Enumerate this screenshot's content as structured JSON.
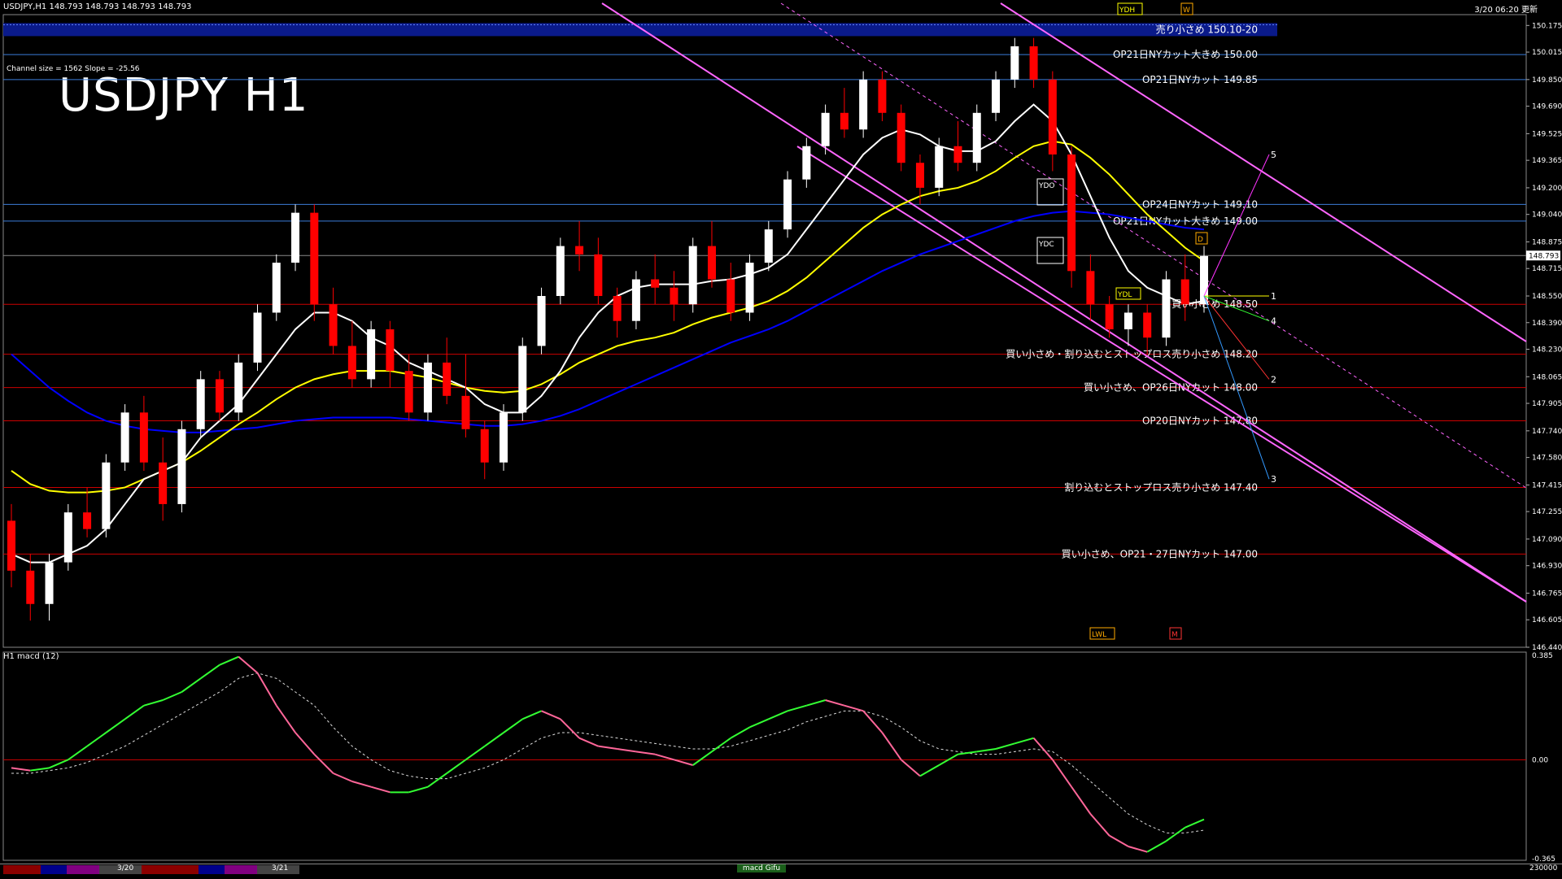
{
  "header": {
    "symbol_line": "USDJPY,H1  148.793 148.793 148.793 148.793",
    "updated": "3/20 06:20 更新"
  },
  "title": "USDJPY H1",
  "channel_info": "Channel size = 1562 Slope = -25.56",
  "macd_label": "H1  macd (12)",
  "colors": {
    "background": "#000000",
    "bull_candle": "#ffffff",
    "bear_candle": "#ff0000",
    "sma_short": "#ffffff",
    "sma_mid": "#ffff00",
    "sma_long": "#0000ff",
    "channel": "#ff66ff",
    "level_blue": "#3b7dd8",
    "level_red": "#cc0000",
    "macd_up": "#33ff33",
    "macd_down": "#ff6699"
  },
  "chart_data": {
    "type": "candlestick",
    "ylim": [
      146.44,
      150.24
    ],
    "price_ticks": [
      "150.175",
      "150.015",
      "149.850",
      "149.690",
      "149.525",
      "149.365",
      "149.200",
      "149.040",
      "148.875",
      "148.715",
      "148.550",
      "148.390",
      "148.230",
      "148.065",
      "147.905",
      "147.740",
      "147.580",
      "147.415",
      "147.255",
      "147.090",
      "146.930",
      "146.765",
      "146.605",
      "146.440"
    ],
    "current_price": "148.793",
    "levels": [
      {
        "price": 150.15,
        "label": "売り小さめ 150.10-20",
        "color": "#cc0000",
        "band": true
      },
      {
        "price": 150.0,
        "label": "OP21日NYカット大きめ 150.00",
        "color": "#3b7dd8"
      },
      {
        "price": 149.85,
        "label": "OP21日NYカット 149.85",
        "color": "#3b7dd8"
      },
      {
        "price": 149.1,
        "label": "OP24日NYカット 149.10",
        "color": "#3b7dd8"
      },
      {
        "price": 149.0,
        "label": "OP21日NYカット大きめ 149.00",
        "color": "#3b7dd8"
      },
      {
        "price": 148.5,
        "label": "買い小さめ 148.50",
        "color": "#cc0000"
      },
      {
        "price": 148.2,
        "label": "買い小さめ・割り込むとストップロス売り小さめ 148.20",
        "color": "#cc0000"
      },
      {
        "price": 148.0,
        "label": "買い小さめ、OP26日NYカット 148.00",
        "color": "#cc0000"
      },
      {
        "price": 147.8,
        "label": "OP20日NYカット 147.80",
        "color": "#cc0000"
      },
      {
        "price": 147.4,
        "label": "割り込むとストップロス売り小さめ 147.40",
        "color": "#cc0000"
      },
      {
        "price": 147.0,
        "label": "買い小さめ、OP21・27日NYカット 147.00",
        "color": "#cc0000"
      }
    ],
    "wave_labels": [
      "1",
      "2",
      "3",
      "4",
      "5"
    ],
    "box_labels": [
      "YDH",
      "YDO",
      "YDC",
      "YDL",
      "LWL",
      "W",
      "D",
      "M"
    ],
    "candles": [
      [
        147.2,
        147.3,
        146.8,
        146.9
      ],
      [
        146.9,
        147.0,
        146.6,
        146.7
      ],
      [
        146.7,
        147.0,
        146.6,
        146.95
      ],
      [
        146.95,
        147.3,
        146.9,
        147.25
      ],
      [
        147.25,
        147.4,
        147.1,
        147.15
      ],
      [
        147.15,
        147.6,
        147.1,
        147.55
      ],
      [
        147.55,
        147.9,
        147.5,
        147.85
      ],
      [
        147.85,
        147.95,
        147.5,
        147.55
      ],
      [
        147.55,
        147.7,
        147.2,
        147.3
      ],
      [
        147.3,
        147.8,
        147.25,
        147.75
      ],
      [
        147.75,
        148.1,
        147.7,
        148.05
      ],
      [
        148.05,
        148.1,
        147.8,
        147.85
      ],
      [
        147.85,
        148.2,
        147.8,
        148.15
      ],
      [
        148.15,
        148.5,
        148.1,
        148.45
      ],
      [
        148.45,
        148.8,
        148.4,
        148.75
      ],
      [
        148.75,
        149.1,
        148.7,
        149.05
      ],
      [
        149.05,
        149.1,
        148.4,
        148.5
      ],
      [
        148.5,
        148.6,
        148.2,
        148.25
      ],
      [
        148.25,
        148.4,
        148.0,
        148.05
      ],
      [
        148.05,
        148.4,
        148.0,
        148.35
      ],
      [
        148.35,
        148.4,
        148.0,
        148.1
      ],
      [
        148.1,
        148.2,
        147.8,
        147.85
      ],
      [
        147.85,
        148.2,
        147.8,
        148.15
      ],
      [
        148.15,
        148.3,
        147.9,
        147.95
      ],
      [
        147.95,
        148.2,
        147.7,
        147.75
      ],
      [
        147.75,
        147.8,
        147.45,
        147.55
      ],
      [
        147.55,
        147.9,
        147.5,
        147.85
      ],
      [
        147.85,
        148.3,
        147.8,
        148.25
      ],
      [
        148.25,
        148.6,
        148.2,
        148.55
      ],
      [
        148.55,
        148.9,
        148.5,
        148.85
      ],
      [
        148.85,
        149.0,
        148.7,
        148.8
      ],
      [
        148.8,
        148.9,
        148.5,
        148.55
      ],
      [
        148.55,
        148.6,
        148.3,
        148.4
      ],
      [
        148.4,
        148.7,
        148.35,
        148.65
      ],
      [
        148.65,
        148.8,
        148.5,
        148.6
      ],
      [
        148.6,
        148.7,
        148.4,
        148.5
      ],
      [
        148.5,
        148.9,
        148.45,
        148.85
      ],
      [
        148.85,
        149.0,
        148.6,
        148.65
      ],
      [
        148.65,
        148.75,
        148.4,
        148.45
      ],
      [
        148.45,
        148.8,
        148.4,
        148.75
      ],
      [
        148.75,
        149.0,
        148.7,
        148.95
      ],
      [
        148.95,
        149.3,
        148.9,
        149.25
      ],
      [
        149.25,
        149.5,
        149.2,
        149.45
      ],
      [
        149.45,
        149.7,
        149.4,
        149.65
      ],
      [
        149.65,
        149.8,
        149.5,
        149.55
      ],
      [
        149.55,
        149.9,
        149.5,
        149.85
      ],
      [
        149.85,
        149.9,
        149.6,
        149.65
      ],
      [
        149.65,
        149.7,
        149.3,
        149.35
      ],
      [
        149.35,
        149.4,
        149.1,
        149.2
      ],
      [
        149.2,
        149.5,
        149.15,
        149.45
      ],
      [
        149.45,
        149.6,
        149.3,
        149.35
      ],
      [
        149.35,
        149.7,
        149.3,
        149.65
      ],
      [
        149.65,
        149.9,
        149.6,
        149.85
      ],
      [
        149.85,
        150.1,
        149.8,
        150.05
      ],
      [
        150.05,
        150.1,
        149.8,
        149.85
      ],
      [
        149.85,
        149.9,
        149.3,
        149.4
      ],
      [
        149.4,
        149.45,
        148.6,
        148.7
      ],
      [
        148.7,
        148.8,
        148.4,
        148.5
      ],
      [
        148.5,
        148.55,
        148.3,
        148.35
      ],
      [
        148.35,
        148.5,
        148.25,
        148.45
      ],
      [
        148.45,
        148.5,
        148.2,
        148.3
      ],
      [
        148.3,
        148.7,
        148.25,
        148.65
      ],
      [
        148.65,
        148.8,
        148.4,
        148.5
      ],
      [
        148.5,
        148.85,
        148.45,
        148.79
      ]
    ],
    "sma_short": [
      147.0,
      146.95,
      146.95,
      147.0,
      147.05,
      147.15,
      147.3,
      147.45,
      147.5,
      147.55,
      147.7,
      147.8,
      147.9,
      148.05,
      148.2,
      148.35,
      148.45,
      148.45,
      148.4,
      148.3,
      148.25,
      148.15,
      148.1,
      148.05,
      148.0,
      147.9,
      147.85,
      147.85,
      147.95,
      148.1,
      148.3,
      148.45,
      148.55,
      148.6,
      148.62,
      148.62,
      148.62,
      148.64,
      148.65,
      148.68,
      148.72,
      148.8,
      148.95,
      149.1,
      149.25,
      149.4,
      149.5,
      149.55,
      149.52,
      149.45,
      149.42,
      149.42,
      149.48,
      149.6,
      149.7,
      149.6,
      149.4,
      149.15,
      148.9,
      148.7,
      148.6,
      148.55,
      148.5,
      148.52
    ],
    "sma_mid": [
      147.5,
      147.42,
      147.38,
      147.37,
      147.37,
      147.38,
      147.4,
      147.45,
      147.5,
      147.55,
      147.62,
      147.7,
      147.78,
      147.85,
      147.93,
      148.0,
      148.05,
      148.08,
      148.1,
      148.1,
      148.1,
      148.08,
      148.06,
      148.03,
      148.0,
      147.98,
      147.97,
      147.98,
      148.02,
      148.08,
      148.15,
      148.2,
      148.25,
      148.28,
      148.3,
      148.33,
      148.38,
      148.42,
      148.45,
      148.48,
      148.52,
      148.58,
      148.66,
      148.76,
      148.86,
      148.96,
      149.04,
      149.1,
      149.15,
      149.18,
      149.2,
      149.24,
      149.3,
      149.38,
      149.45,
      149.48,
      149.46,
      149.38,
      149.28,
      149.16,
      149.04,
      148.94,
      148.84,
      148.76
    ],
    "sma_long": [
      148.2,
      148.1,
      148.0,
      147.92,
      147.85,
      147.8,
      147.77,
      147.75,
      147.74,
      147.73,
      147.73,
      147.74,
      147.75,
      147.76,
      147.78,
      147.8,
      147.81,
      147.82,
      147.82,
      147.82,
      147.82,
      147.81,
      147.8,
      147.79,
      147.78,
      147.77,
      147.77,
      147.78,
      147.8,
      147.83,
      147.87,
      147.92,
      147.97,
      148.02,
      148.07,
      148.12,
      148.17,
      148.22,
      148.27,
      148.31,
      148.35,
      148.4,
      148.46,
      148.52,
      148.58,
      148.64,
      148.7,
      148.75,
      148.8,
      148.84,
      148.88,
      148.92,
      148.96,
      149.0,
      149.03,
      149.05,
      149.06,
      149.05,
      149.04,
      149.02,
      149.0,
      148.98,
      148.96,
      148.95
    ],
    "macd": {
      "ylim": [
        -0.365,
        0.385
      ],
      "ticks": [
        "0.385",
        "0.00",
        "-0.365"
      ],
      "main": [
        -0.03,
        -0.04,
        -0.03,
        0.0,
        0.05,
        0.1,
        0.15,
        0.2,
        0.22,
        0.25,
        0.3,
        0.35,
        0.38,
        0.32,
        0.2,
        0.1,
        0.02,
        -0.05,
        -0.08,
        -0.1,
        -0.12,
        -0.12,
        -0.1,
        -0.05,
        -0.0,
        0.05,
        0.1,
        0.15,
        0.18,
        0.15,
        0.08,
        0.05,
        0.04,
        0.03,
        0.02,
        0.0,
        -0.02,
        0.03,
        0.08,
        0.12,
        0.15,
        0.18,
        0.2,
        0.22,
        0.2,
        0.18,
        0.1,
        0.0,
        -0.06,
        -0.02,
        0.02,
        0.03,
        0.04,
        0.06,
        0.08,
        0.0,
        -0.1,
        -0.2,
        -0.28,
        -0.32,
        -0.34,
        -0.3,
        -0.25,
        -0.22
      ],
      "signal": [
        -0.05,
        -0.05,
        -0.04,
        -0.03,
        -0.01,
        0.02,
        0.05,
        0.09,
        0.13,
        0.17,
        0.21,
        0.25,
        0.3,
        0.32,
        0.3,
        0.25,
        0.2,
        0.12,
        0.05,
        0.0,
        -0.04,
        -0.06,
        -0.07,
        -0.07,
        -0.05,
        -0.03,
        0.0,
        0.04,
        0.08,
        0.1,
        0.1,
        0.09,
        0.08,
        0.07,
        0.06,
        0.05,
        0.04,
        0.04,
        0.05,
        0.07,
        0.09,
        0.11,
        0.14,
        0.16,
        0.18,
        0.18,
        0.16,
        0.12,
        0.07,
        0.04,
        0.03,
        0.02,
        0.02,
        0.03,
        0.04,
        0.03,
        -0.02,
        -0.08,
        -0.14,
        -0.2,
        -0.24,
        -0.27,
        -0.27,
        -0.26
      ]
    },
    "date_labels": [
      "3/20",
      "3/21"
    ],
    "bottom_center_label": "macd Gifu",
    "bottom_right_label": "230000"
  }
}
